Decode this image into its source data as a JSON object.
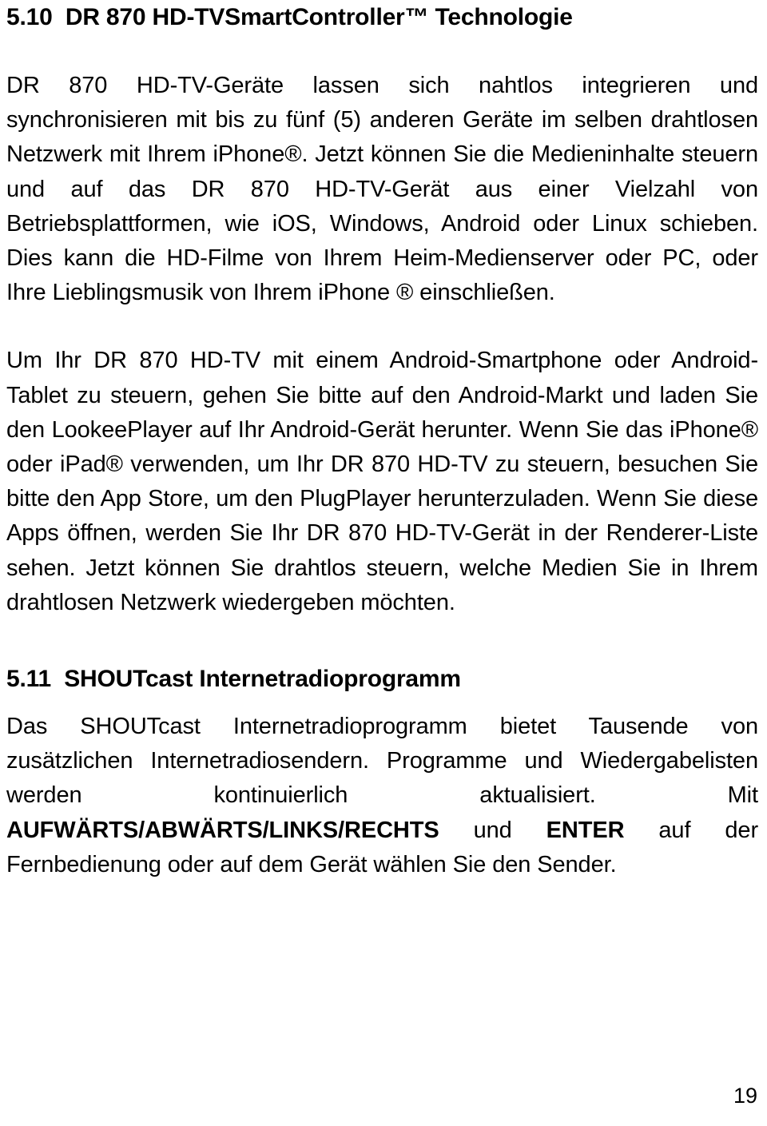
{
  "document": {
    "page_number": "19",
    "sections": [
      {
        "id": "5.10",
        "heading": "5.10  DR 870 HD-TVSmartController™ Technologie",
        "paragraphs": [
          {
            "id": "p-5-10-1",
            "text": "DR 870 HD-TV-Geräte lassen sich nahtlos integrieren und synchronisieren mit bis zu fünf (5) anderen Geräte im selben drahtlosen Netzwerk mit Ihrem iPhone®. Jetzt können Sie die Medieninhalte steuern und auf das DR 870 HD-TV-Gerät aus einer Vielzahl von Betriebsplattformen, wie iOS, Windows, Android oder Linux schieben. Dies kann die HD-Filme von Ihrem Heim-Medienserver oder PC, oder Ihre Lieblingsmusik von Ihrem iPhone ® einschließen."
          },
          {
            "id": "p-5-10-2",
            "text": "Um Ihr DR 870 HD-TV mit einem Android-Smartphone oder Android-Tablet zu steuern, gehen Sie bitte auf den Android-Markt und laden Sie den LookeePlayer auf Ihr Android-Gerät herunter. Wenn Sie das iPhone® oder iPad® verwenden, um Ihr DR 870 HD-TV zu steuern, besuchen Sie bitte den App Store, um den PlugPlayer herunterzuladen. Wenn Sie diese Apps öffnen, werden Sie Ihr DR 870 HD-TV-Gerät in der Renderer-Liste sehen. Jetzt können Sie drahtlos steuern, welche Medien Sie in Ihrem drahtlosen Netzwerk wiedergeben möchten."
          }
        ]
      },
      {
        "id": "5.11",
        "heading": "5.11  SHOUTcast Internetradioprogramm",
        "paragraph_parts": {
          "lead": "Das SHOUTcast Internetradioprogramm bietet Tausende von zusätzlichen Internetradiosendern. Programme und Wiedergabelisten werden kontinuierlich aktualisiert. Mit ",
          "bold_1": "AUFWÄRTS/ABWÄRTS/LINKS/RECHTS",
          "middle": " und ",
          "bold_2": "ENTER",
          "tail": " auf der Fernbedienung oder auf dem Gerät wählen Sie den Sender."
        }
      }
    ]
  }
}
